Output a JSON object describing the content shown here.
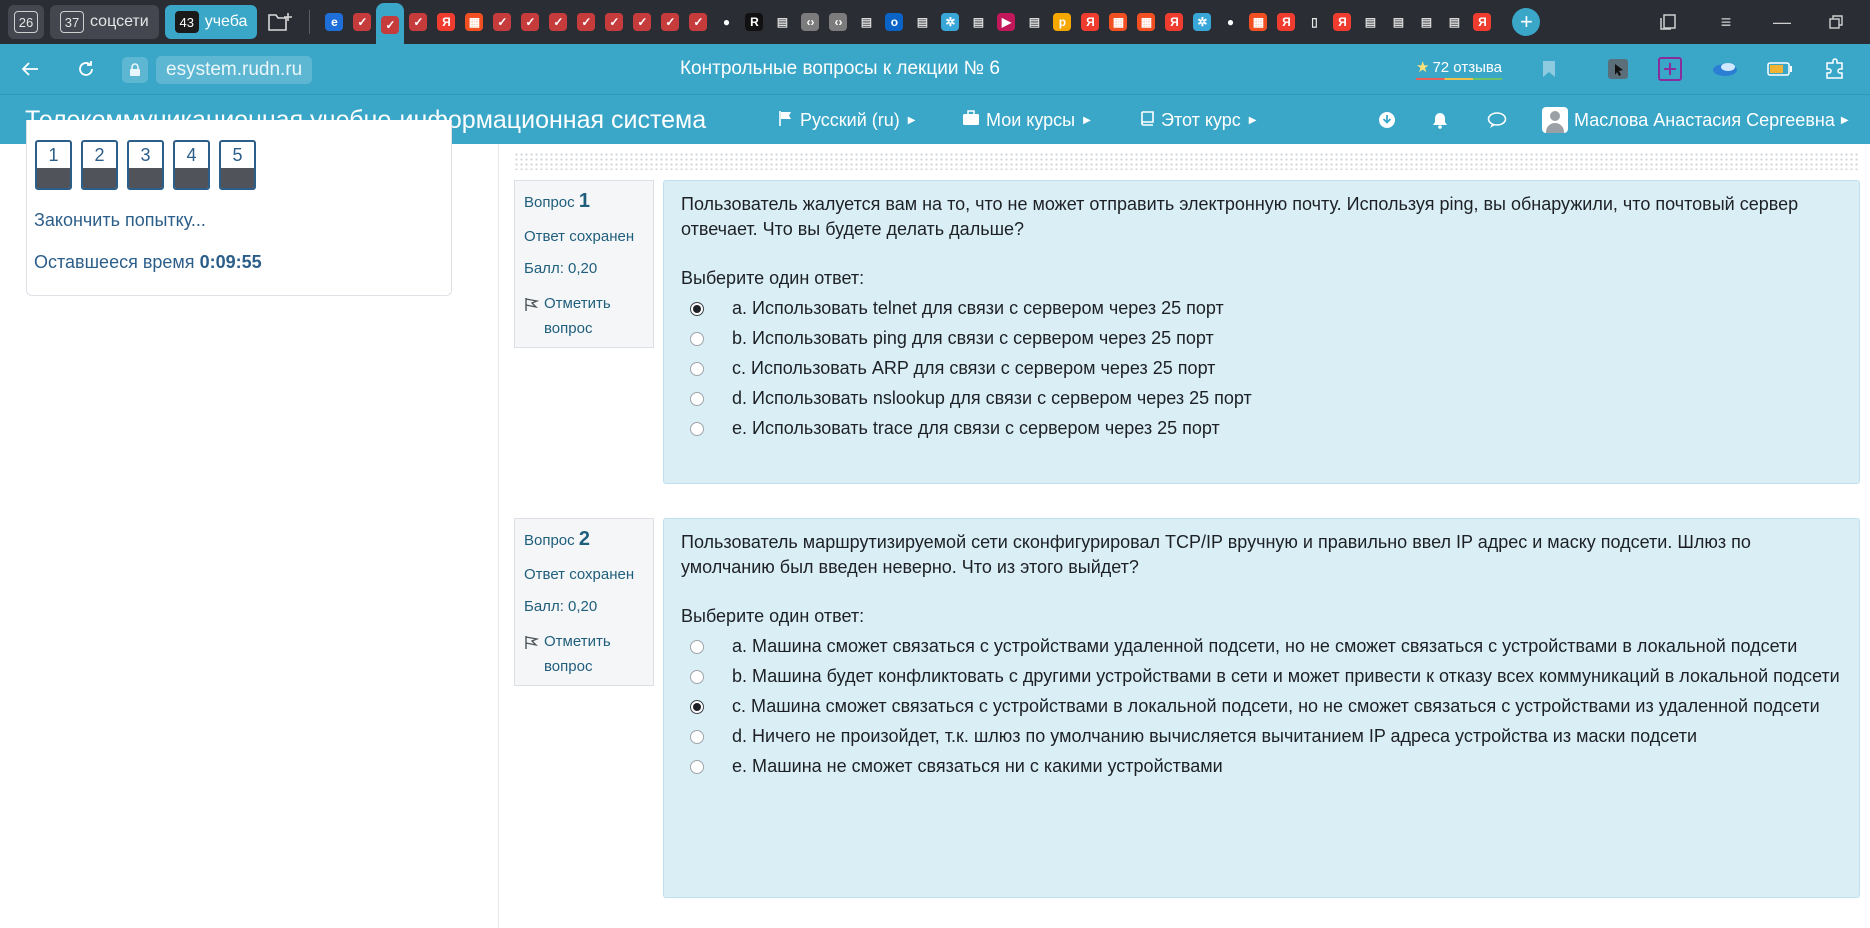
{
  "tabstrip": {
    "groups": [
      {
        "count": "26",
        "label": ""
      },
      {
        "count": "37",
        "label": "соцсети"
      },
      {
        "count": "43",
        "label": "учеба"
      }
    ],
    "pinned_icons": [
      "edge-icon",
      "tab-icon",
      "tab-icon",
      "tab-icon",
      "yandex-icon",
      "windows-icon",
      "tab-icon",
      "tab-icon",
      "tab-icon",
      "tab-icon",
      "tab-icon",
      "tab-icon",
      "tab-icon",
      "tab-icon",
      "github-icon",
      "r-icon",
      "docs-icon",
      "code-icon",
      "code-icon",
      "docs-icon",
      "outlook-icon",
      "docs-icon",
      "snowflake-icon",
      "docs-icon",
      "play-icon",
      "docs-icon",
      "p-icon",
      "yandex-icon",
      "windows-icon",
      "windows-icon",
      "yandex-icon",
      "snowflake-icon",
      "github-icon",
      "windows-icon",
      "yandex-icon",
      "file-icon",
      "yandex-icon",
      "docs-icon",
      "docs-icon",
      "docs-icon",
      "docs-icon",
      "yandex-icon"
    ]
  },
  "addressbar": {
    "url": "esystem.rudn.ru",
    "page_title": "Контрольные вопросы к лекции № 6",
    "reviews": "72 отзыва"
  },
  "header": {
    "site_name": "Телекоммуникационная учебно-информационная система",
    "language": "Русский (ru)",
    "my_courses": "Мои курсы",
    "this_course": "Этот курс",
    "user_name": "Маслова Анастасия Сергеевна"
  },
  "nav": {
    "questions": [
      "1",
      "2",
      "3",
      "4",
      "5"
    ],
    "finish_attempt": "Закончить попытку...",
    "time_left_label": "Оставшееся время",
    "time_left_value": "0:09:55"
  },
  "questions": [
    {
      "label": "Вопрос",
      "number": "1",
      "status": "Ответ сохранен",
      "score": "Балл: 0,20",
      "flag_label": "Отметить вопрос",
      "text": "Пользователь жалуется вам на то, что не может отправить электронную почту. Используя ping, вы обнаружили, что почтовый сервер отвечает. Что вы будете делать дальше?",
      "prompt": "Выберите один ответ:",
      "answers": [
        {
          "letter": "a.",
          "text": "Использовать telnet для связи с сервером через 25 порт",
          "checked": true
        },
        {
          "letter": "b.",
          "text": "Использовать ping для связи с сервером через 25 порт",
          "checked": false
        },
        {
          "letter": "c.",
          "text": "Использовать ARP для связи с сервером через 25 порт",
          "checked": false
        },
        {
          "letter": "d.",
          "text": "Использовать nslookup для связи с сервером через 25 порт",
          "checked": false
        },
        {
          "letter": "e.",
          "text": "Использовать trace для связи с сервером через 25 порт",
          "checked": false
        }
      ]
    },
    {
      "label": "Вопрос",
      "number": "2",
      "status": "Ответ сохранен",
      "score": "Балл: 0,20",
      "flag_label": "Отметить вопрос",
      "text": "Пользователь маршрутизируемой сети сконфигурировал TCP/IP вручную и правильно ввел IP адрес и маску подсети. Шлюз по умолчанию был введен неверно. Что из этого выйдет?",
      "prompt": "Выберите один ответ:",
      "answers": [
        {
          "letter": "a.",
          "text": "Машина сможет связаться с устройствами удаленной подсети, но не сможет связаться с устройствами в локальной подсети",
          "checked": false
        },
        {
          "letter": "b.",
          "text": "Машина будет конфликтовать с другими устройствами в сети и может привести к отказу всех коммуникаций в локальной подсети",
          "checked": false
        },
        {
          "letter": "c.",
          "text": "Машина сможет связаться с устройствами в локальной подсети, но не сможет связаться с устройствами из удаленной подсети",
          "checked": true
        },
        {
          "letter": "d.",
          "text": "Ничего не произойдет, т.к. шлюз по умолчанию вычисляется вычитанием IP адреса устройства из маски подсети",
          "checked": false
        },
        {
          "letter": "e.",
          "text": "Машина не сможет связаться ни с какими устройствами",
          "checked": false
        }
      ]
    }
  ]
}
